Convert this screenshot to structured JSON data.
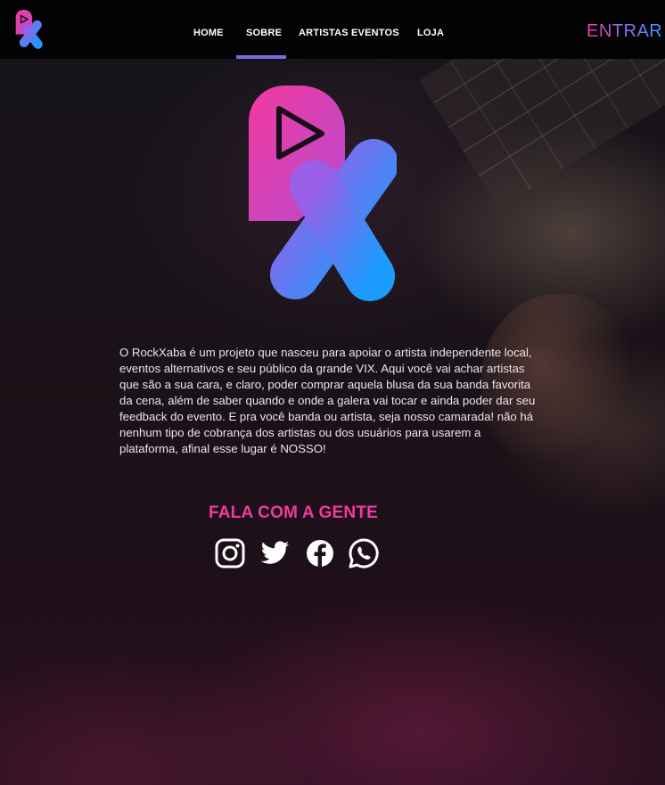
{
  "nav": {
    "logo_icon": "rockxaba-logo-icon",
    "items": [
      {
        "label": "HOME",
        "active": false
      },
      {
        "label": "SOBRE",
        "active": true
      },
      {
        "label": "ARTISTAS",
        "active": false
      },
      {
        "label": "EVENTOS",
        "active": false
      },
      {
        "label": "LOJA",
        "active": false
      }
    ],
    "enter_label": "ENTRAR"
  },
  "hero": {
    "logo_icon": "rockxaba-logo-icon"
  },
  "about": {
    "text": "O RockXaba é um projeto que nasceu para apoiar o artista independente local, eventos alternativos e seu público da grande VIX. Aqui você vai achar artistas que são a sua cara, e claro, poder comprar aquela blusa da sua banda favorita da cena, além de saber quando e onde a galera  vai tocar e ainda poder dar seu feedback do evento. E pra você banda ou artista, seja nosso camarada! não há nenhum tipo de cobrança dos artistas ou dos usuários para usarem a plataforma, afinal esse lugar é NOSSO!"
  },
  "contact": {
    "title": "FALA COM A GENTE",
    "socials": [
      {
        "icon": "instagram-icon"
      },
      {
        "icon": "twitter-icon"
      },
      {
        "icon": "facebook-icon"
      },
      {
        "icon": "whatsapp-icon"
      }
    ]
  },
  "colors": {
    "brand_pink": "#f23a9e",
    "brand_purple": "#8d6cf2",
    "brand_blue": "#1e9bff",
    "nav_active_bar": "#7b6be0",
    "nav_background": "#030303"
  }
}
